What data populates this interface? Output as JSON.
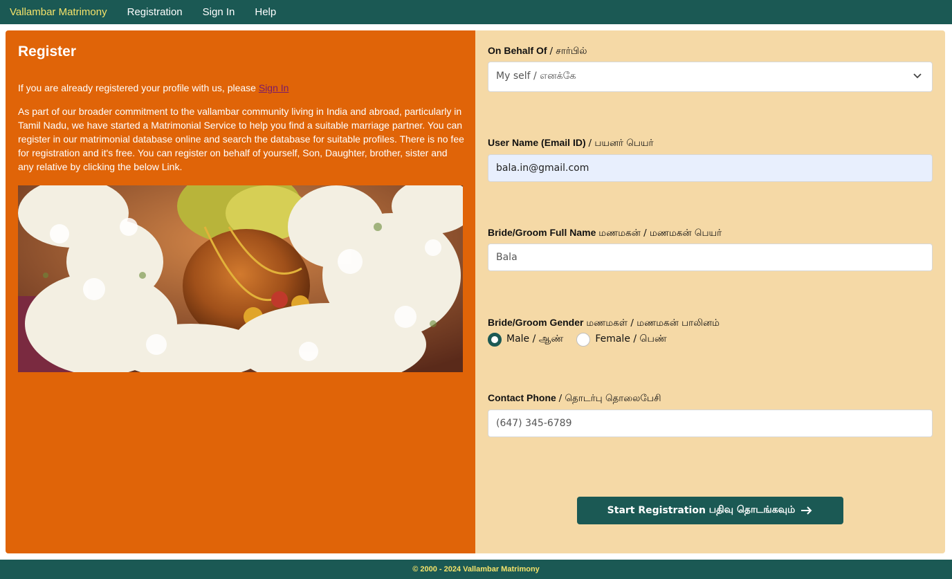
{
  "nav": {
    "brand": "Vallambar Matrimony",
    "links": [
      "Registration",
      "Sign In",
      "Help"
    ]
  },
  "left": {
    "title": "Register",
    "intro_text": "If you are already registered your profile with us, please ",
    "signin_link": "Sign In",
    "description": "As part of our broader commitment to the vallambar community living in India and abroad, particularly in Tamil Nadu, we have started a Matrimonial Service to help you find a suitable marriage partner. You can register in our matrimonial database online and search the database for suitable profiles. There is no fee for registration and it's free. You can register on behalf of yourself, Son, Daughter, brother, sister and any relative by clicking the below Link."
  },
  "form": {
    "behalf": {
      "label": "On Behalf Of",
      "label_ta": "/ சார்பில்",
      "value": "My self / எனக்கே"
    },
    "username": {
      "label": "User Name (Email ID)",
      "label_ta": "/ பயனர் பெயர்",
      "value": "bala.in@gmail.com"
    },
    "fullname": {
      "label": "Bride/Groom Full Name",
      "label_ta": "மணமகன் / மணமகன் பெயர்",
      "placeholder": "Bala"
    },
    "gender": {
      "label": "Bride/Groom Gender",
      "label_ta": "மணமகள் / மணமகன் பாலினம்",
      "options": [
        "Male / ஆண்",
        "Female / பெண்"
      ],
      "selected": "Male / ஆண்"
    },
    "phone": {
      "label": "Contact Phone",
      "label_ta": "/ தொடர்பு தொலைபேசி",
      "placeholder": "(647) 345-6789"
    },
    "submit": "Start Registration",
    "submit_ta": "பதிவு தொடங்கவும்"
  },
  "footer": "© 2000 - 2024 Vallambar Matrimony",
  "colors": {
    "nav_bg": "#1b5954",
    "brand": "#f5e36a",
    "left_bg": "#e06408",
    "right_bg": "#f5d9a6",
    "button_bg": "#1b5954"
  }
}
